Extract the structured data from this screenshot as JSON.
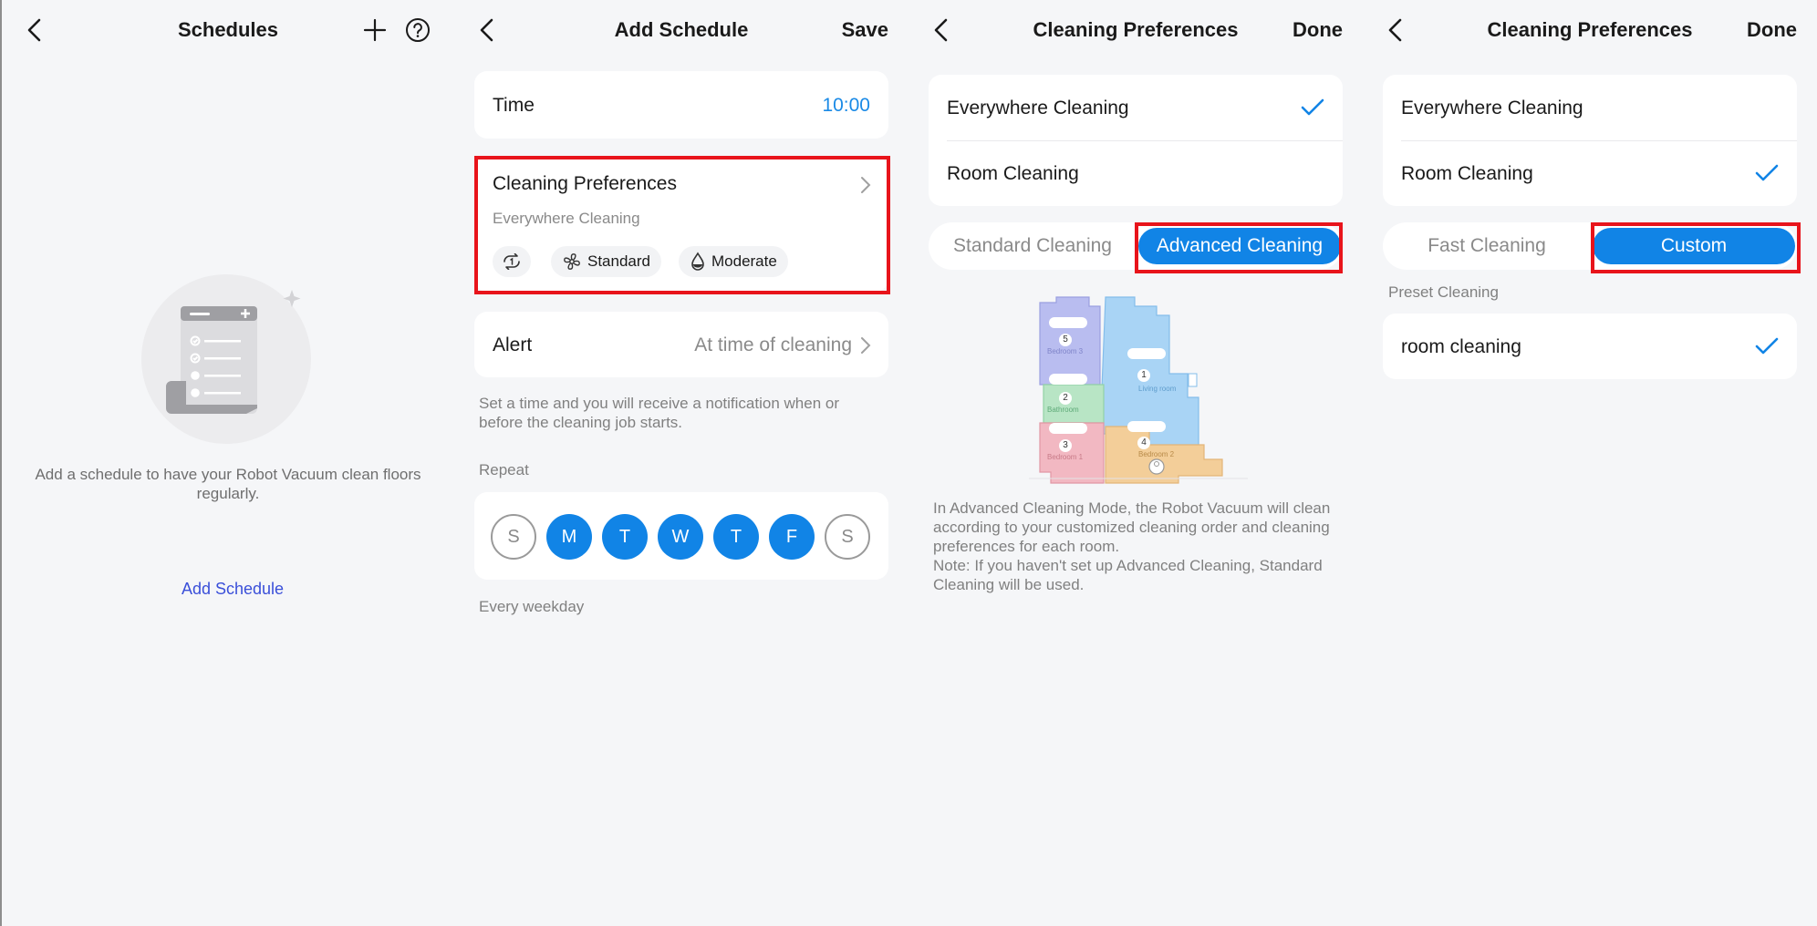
{
  "panels": {
    "schedules": {
      "title": "Schedules",
      "empty_message": "Add a schedule to have your Robot Vacuum clean floors regularly.",
      "add_link": "Add Schedule"
    },
    "add_schedule": {
      "title": "Add Schedule",
      "save_label": "Save",
      "time_label": "Time",
      "time_value": "10:00",
      "prefs_label": "Cleaning Preferences",
      "prefs_mode": "Everywhere Cleaning",
      "chips": [
        {
          "icon": "repeat-once-icon",
          "label": ""
        },
        {
          "icon": "fan-icon",
          "label": "Standard"
        },
        {
          "icon": "water-drop-icon",
          "label": "Moderate"
        }
      ],
      "alert_label": "Alert",
      "alert_value": "At time of cleaning",
      "alert_note": "Set a time and you will receive a notification when or before the cleaning job starts.",
      "repeat_label": "Repeat",
      "days": [
        {
          "letter": "S",
          "selected": false
        },
        {
          "letter": "M",
          "selected": true
        },
        {
          "letter": "T",
          "selected": true
        },
        {
          "letter": "W",
          "selected": true
        },
        {
          "letter": "T",
          "selected": true
        },
        {
          "letter": "F",
          "selected": true
        },
        {
          "letter": "S",
          "selected": false
        }
      ],
      "repeat_summary": "Every weekday"
    },
    "prefs_advanced": {
      "title": "Cleaning Preferences",
      "done_label": "Done",
      "options": [
        "Everywhere Cleaning",
        "Room Cleaning"
      ],
      "selected_option": "Everywhere Cleaning",
      "segments": [
        "Standard Cleaning",
        "Advanced Cleaning"
      ],
      "selected_segment": "Advanced Cleaning",
      "map_rooms": [
        {
          "number": "5",
          "name": "Bedroom 3"
        },
        {
          "number": "1",
          "name": "Living room"
        },
        {
          "number": "2",
          "name": "Bathroom"
        },
        {
          "number": "3",
          "name": "Bedroom 1"
        },
        {
          "number": "4",
          "name": "Bedroom 2"
        }
      ],
      "description": "In Advanced Cleaning Mode, the Robot Vacuum will clean according to your customized cleaning order and cleaning preferences for each room.\nNote: If you haven't set up Advanced Cleaning, Standard Cleaning will be used."
    },
    "prefs_custom": {
      "title": "Cleaning Preferences",
      "done_label": "Done",
      "options": [
        "Everywhere Cleaning",
        "Room Cleaning"
      ],
      "selected_option": "Room Cleaning",
      "segments": [
        "Fast Cleaning",
        "Custom"
      ],
      "selected_segment": "Custom",
      "preset_header": "Preset Cleaning",
      "preset_item": "room cleaning"
    }
  },
  "colors": {
    "accent": "#1184e6",
    "highlight_box": "#e8141b",
    "link": "#3a4fd9",
    "background": "#f5f6f8"
  }
}
